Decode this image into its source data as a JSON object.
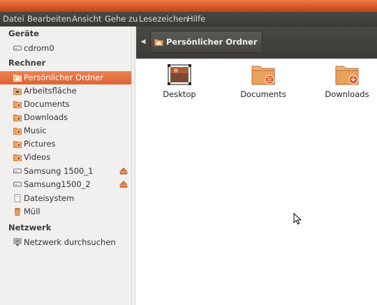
{
  "menu": [
    "Datei",
    "Bearbeiten",
    "Ansicht",
    "Gehe zu",
    "Lesezeichen",
    "Hilfe"
  ],
  "sidebar": {
    "sections": [
      {
        "title": "Geräte",
        "items": [
          {
            "label": "cdrom0",
            "icon": "drive-icon"
          }
        ]
      },
      {
        "title": "Rechner",
        "items": [
          {
            "label": "Persönlicher Ordner",
            "icon": "home-folder-icon",
            "selected": true
          },
          {
            "label": "Arbeitsfläche",
            "icon": "desktop-icon"
          },
          {
            "label": "Documents",
            "icon": "folder-icon"
          },
          {
            "label": "Downloads",
            "icon": "folder-icon"
          },
          {
            "label": "Music",
            "icon": "folder-icon"
          },
          {
            "label": "Pictures",
            "icon": "folder-icon"
          },
          {
            "label": "Videos",
            "icon": "folder-icon"
          },
          {
            "label": "Samsung 1500_1",
            "icon": "drive-icon",
            "eject": true
          },
          {
            "label": "Samsung1500_2",
            "icon": "drive-icon",
            "eject": true
          },
          {
            "label": "Dateisystem",
            "icon": "filesystem-icon"
          },
          {
            "label": "Müll",
            "icon": "trash-icon"
          }
        ]
      },
      {
        "title": "Netzwerk",
        "items": [
          {
            "label": "Netzwerk durchsuchen",
            "icon": "network-icon"
          }
        ]
      }
    ]
  },
  "location": {
    "crumb": "Persönlicher Ordner"
  },
  "files": [
    {
      "name": "Desktop",
      "icon": "desktop-folder-icon"
    },
    {
      "name": "Documents",
      "icon": "documents-folder-icon"
    },
    {
      "name": "Downloads",
      "icon": "downloads-folder-icon"
    }
  ],
  "colors": {
    "accent": "#dd6233",
    "folder": "#e8a25c",
    "dark_bar": "#3c3b37"
  }
}
